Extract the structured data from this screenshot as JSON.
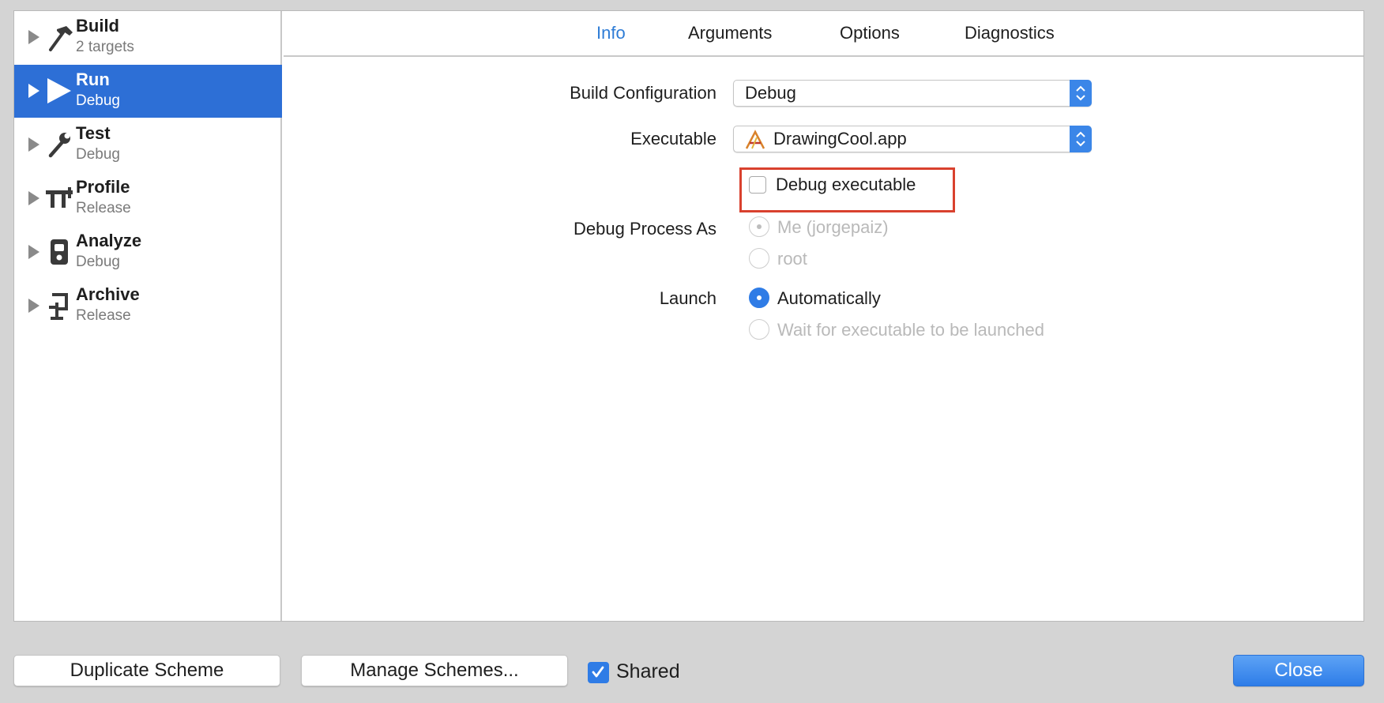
{
  "sidebar": {
    "actions": [
      {
        "name": "Build",
        "sub": "2 targets",
        "icon": "hammer-icon"
      },
      {
        "name": "Run",
        "sub": "Debug",
        "icon": "play-icon"
      },
      {
        "name": "Test",
        "sub": "Debug",
        "icon": "wrench-icon"
      },
      {
        "name": "Profile",
        "sub": "Release",
        "icon": "caliper-icon"
      },
      {
        "name": "Analyze",
        "sub": "Debug",
        "icon": "analyze-icon"
      },
      {
        "name": "Archive",
        "sub": "Release",
        "icon": "clamp-icon"
      }
    ],
    "selected": "Run"
  },
  "tabs": [
    {
      "label": "Info",
      "active": true
    },
    {
      "label": "Arguments",
      "active": false
    },
    {
      "label": "Options",
      "active": false
    },
    {
      "label": "Diagnostics",
      "active": false
    }
  ],
  "info": {
    "build_config_label": "Build Configuration",
    "build_config_value": "Debug",
    "executable_label": "Executable",
    "executable_value": "DrawingCool.app",
    "debug_executable_label": "Debug executable",
    "debug_executable_checked": false,
    "debug_process_label": "Debug Process As",
    "debug_process_options": [
      "Me (jorgepaiz)",
      "root"
    ],
    "launch_label": "Launch",
    "launch_options": [
      "Automatically",
      "Wait for executable to be launched"
    ]
  },
  "footer": {
    "duplicate_label": "Duplicate Scheme",
    "manage_label": "Manage Schemes...",
    "shared_label": "Shared",
    "shared_checked": true,
    "close_label": "Close"
  },
  "colors": {
    "accent": "#2d6fd6",
    "highlight_box": "#d9412e",
    "active_tab": "#2e7cd6"
  }
}
